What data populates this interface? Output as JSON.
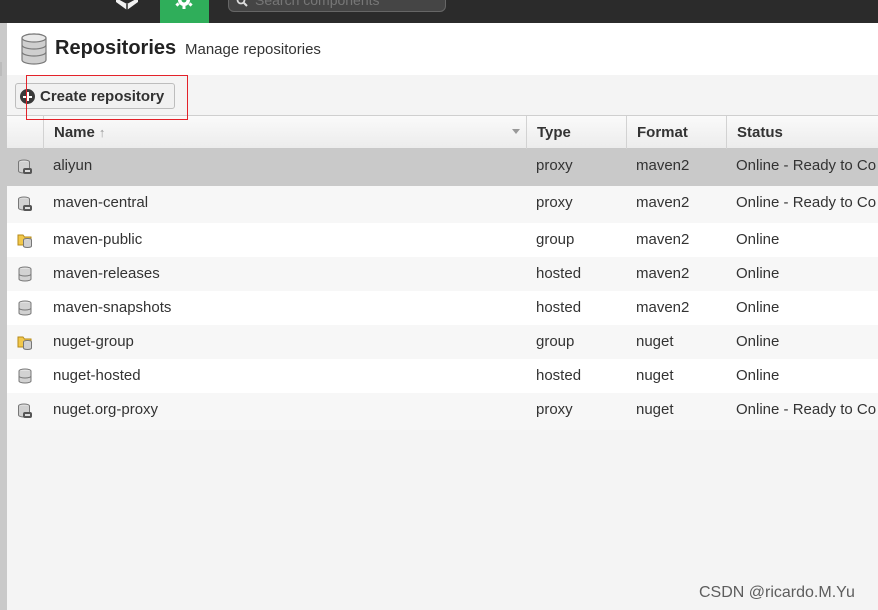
{
  "topbar": {
    "search_placeholder": "Search components",
    "icons": [
      "cube-icon",
      "gear-icon",
      "search-icon"
    ],
    "accent_color": "#2fae5a"
  },
  "page": {
    "title": "Repositories",
    "subtitle": "Manage repositories",
    "icon": "database-icon"
  },
  "toolbar": {
    "create_label": "Create repository",
    "create_icon": "plus-circle-icon",
    "highlight_color": "#e3222a"
  },
  "grid": {
    "columns": [
      "Name",
      "Type",
      "Format",
      "Status"
    ],
    "sort_indicator": "↑",
    "rows": [
      {
        "name": "aliyun",
        "type": "proxy",
        "format": "maven2",
        "status": "Online - Ready to Co",
        "icon": "proxy-repo-icon"
      },
      {
        "name": "maven-central",
        "type": "proxy",
        "format": "maven2",
        "status": "Online - Ready to Co",
        "icon": "proxy-repo-icon"
      },
      {
        "name": "maven-public",
        "type": "group",
        "format": "maven2",
        "status": "Online",
        "icon": "group-repo-icon"
      },
      {
        "name": "maven-releases",
        "type": "hosted",
        "format": "maven2",
        "status": "Online",
        "icon": "hosted-repo-icon"
      },
      {
        "name": "maven-snapshots",
        "type": "hosted",
        "format": "maven2",
        "status": "Online",
        "icon": "hosted-repo-icon"
      },
      {
        "name": "nuget-group",
        "type": "group",
        "format": "nuget",
        "status": "Online",
        "icon": "group-repo-icon"
      },
      {
        "name": "nuget-hosted",
        "type": "hosted",
        "format": "nuget",
        "status": "Online",
        "icon": "hosted-repo-icon"
      },
      {
        "name": "nuget.org-proxy",
        "type": "proxy",
        "format": "nuget",
        "status": "Online - Ready to Co",
        "icon": "proxy-repo-icon"
      }
    ]
  },
  "watermark": "CSDN @ricardo.M.Yu"
}
